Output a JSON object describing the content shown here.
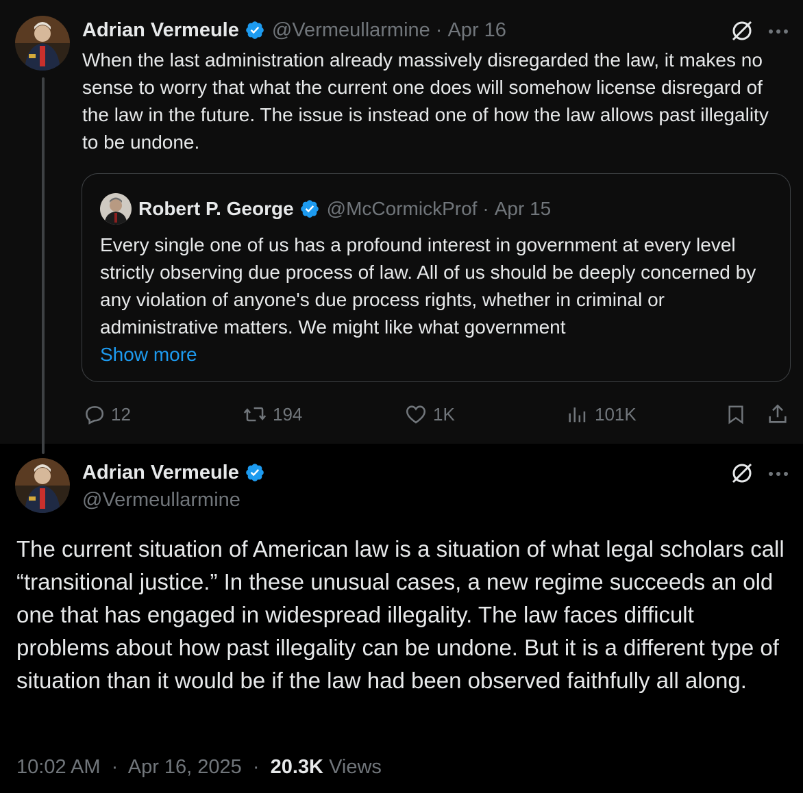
{
  "first_tweet": {
    "author_name": "Adrian Vermeule",
    "handle": "@Vermeullarmine",
    "separator": "·",
    "date": "Apr 16",
    "text": "When the last administration already massively disregarded the law, it makes no sense to worry that what the current one does will somehow license disregard of the law in the future. The issue is instead one of how the law allows past illegality to be undone.",
    "quote": {
      "author_name": "Robert P. George",
      "handle": "@McCormickProf",
      "separator": "·",
      "date": "Apr 15",
      "text": "Every single one of us has a profound interest in government at every level strictly observing due process of law. All of us should be deeply concerned by any violation of anyone's due process rights, whether in criminal or administrative matters. We might like what government",
      "show_more": "Show more"
    },
    "actions": {
      "replies": "12",
      "reposts": "194",
      "likes": "1K",
      "views": "101K"
    }
  },
  "main_tweet": {
    "author_name": "Adrian Vermeule",
    "handle": "@Vermeullarmine",
    "text": "The current situation of American law is a situation of what legal scholars call “transitional justice.” In these unusual cases, a new regime succeeds an old one that has engaged in widespread illegality. The law faces difficult problems about how past illegality can be undone. But it is a different type of situation than it would be if the law had been observed faithfully all along.",
    "time": "10:02 AM",
    "date": "Apr 16, 2025",
    "separator": "·",
    "views_count": "20.3K",
    "views_label": "Views"
  },
  "icons": {
    "verified": "verified-badge-icon",
    "grok": "grok-icon",
    "more": "more-icon",
    "reply": "reply-icon",
    "repost": "repost-icon",
    "like": "like-icon",
    "views": "views-icon",
    "bookmark": "bookmark-icon",
    "share": "share-icon"
  },
  "colors": {
    "background": "#000000",
    "thread_background": "#0d0d0d",
    "text": "#e7e9ea",
    "secondary": "#71767b",
    "accent": "#1d9bf0",
    "border": "#3e4144"
  }
}
